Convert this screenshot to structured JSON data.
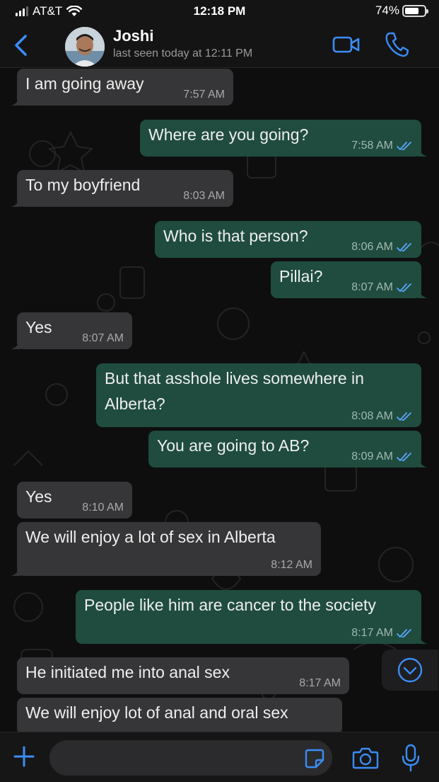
{
  "status_bar": {
    "carrier": "AT&T",
    "time": "12:18 PM",
    "battery": "74%",
    "battery_level": 0.74
  },
  "header": {
    "contact_name": "Joshi",
    "last_seen": "last seen today at 12:11 PM",
    "icons": [
      "chevron-left-icon",
      "avatar",
      "video-call-icon",
      "phone-icon"
    ]
  },
  "messages": [
    {
      "dir": "in",
      "text": "I am going away",
      "time": "7:57 AM"
    },
    {
      "dir": "out",
      "text": "Where are you going?",
      "time": "7:58 AM",
      "read": true
    },
    {
      "dir": "in",
      "text": "To my boyfriend",
      "time": "8:03 AM"
    },
    {
      "dir": "out",
      "text": "Who is that person?",
      "time": "8:06 AM",
      "read": true
    },
    {
      "dir": "out",
      "text": "Pillai?",
      "time": "8:07 AM",
      "read": true
    },
    {
      "dir": "in",
      "text": "Yes",
      "time": "8:07 AM"
    },
    {
      "dir": "out",
      "text": "But that asshole lives somewhere in",
      "text2": "Alberta?",
      "time": "8:08 AM",
      "read": true
    },
    {
      "dir": "out",
      "text": "You are going to AB?",
      "time": "8:09 AM",
      "read": true
    },
    {
      "dir": "in",
      "text": "Yes",
      "time": "8:10 AM"
    },
    {
      "dir": "in",
      "text": "We will enjoy a lot of sex in Alberta",
      "time": "8:12 AM"
    },
    {
      "dir": "out",
      "text": "People like him are cancer to the society",
      "time": "8:17 AM",
      "read": true
    },
    {
      "dir": "in",
      "text": "He initiated me into anal sex",
      "time": "8:17 AM"
    },
    {
      "dir": "in",
      "text": "We will enjoy lot of anal and oral sex",
      "time": ""
    }
  ],
  "input_bar": {
    "placeholder": "",
    "icons": [
      "plus-icon",
      "sticker-icon",
      "camera-icon",
      "microphone-icon"
    ]
  },
  "colors": {
    "accent": "#3b8df6",
    "incoming_bubble": "#363638",
    "outgoing_bubble": "#1f4c3f",
    "read_ticks": "#5aa8ff"
  }
}
